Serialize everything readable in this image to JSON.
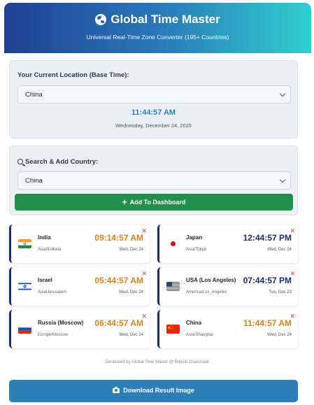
{
  "header": {
    "title": "Global Time Master",
    "subtitle": "Universal Real-Time Zone Converter (195+ Countries)",
    "icon": "globe-icon"
  },
  "base": {
    "label": "Your Current Location (Base Time):",
    "selected": "China",
    "time": "11:44:57 AM",
    "date": "Wednesday, December 24, 2025"
  },
  "search": {
    "label": "Search & Add Country:",
    "selected": "China",
    "add_label": "Add To Dashboard"
  },
  "cards": [
    {
      "name": "India",
      "tz": "Asia/Kolkata",
      "time": "09:14:57 AM",
      "date": "Wed, Dec 24",
      "flag": "india-flag",
      "time_color": "#d88222"
    },
    {
      "name": "Japan",
      "tz": "Asia/Tokyo",
      "time": "12:44:57 PM",
      "date": "Wed, Dec 24",
      "flag": "japan-flag",
      "time_color": "#1f2f6a"
    },
    {
      "name": "Israel",
      "tz": "Asia/Jerusalem",
      "time": "05:44:57 AM",
      "date": "Wed, Dec 24",
      "flag": "israel-flag",
      "time_color": "#d88222"
    },
    {
      "name": "USA (Los Angeles)",
      "tz": "America/Los_Angeles",
      "time": "07:44:57 PM",
      "date": "Tue, Dec 23",
      "flag": "usa-flag",
      "time_color": "#1f2f6a"
    },
    {
      "name": "Russia (Moscow)",
      "tz": "Europe/Moscow",
      "time": "06:44:57 AM",
      "date": "Wed, Dec 24",
      "flag": "russia-flag",
      "time_color": "#d88222"
    },
    {
      "name": "China",
      "tz": "Asia/Shanghai",
      "time": "11:44:57 AM",
      "date": "Wed, Dec 24",
      "flag": "china-flag",
      "time_color": "#d88222"
    }
  ],
  "footer": {
    "note": "Generated by Global Time Master @ Brijesh Chaturvedi",
    "download_label": "Download Result Image"
  },
  "colors": {
    "header_start": "#1f3f92",
    "header_end": "#2fd0cf",
    "accent_blue": "#2d7fc0",
    "add_green": "#228f4d",
    "card_border": "#1f2f6a",
    "close_red": "#c84a3c"
  }
}
